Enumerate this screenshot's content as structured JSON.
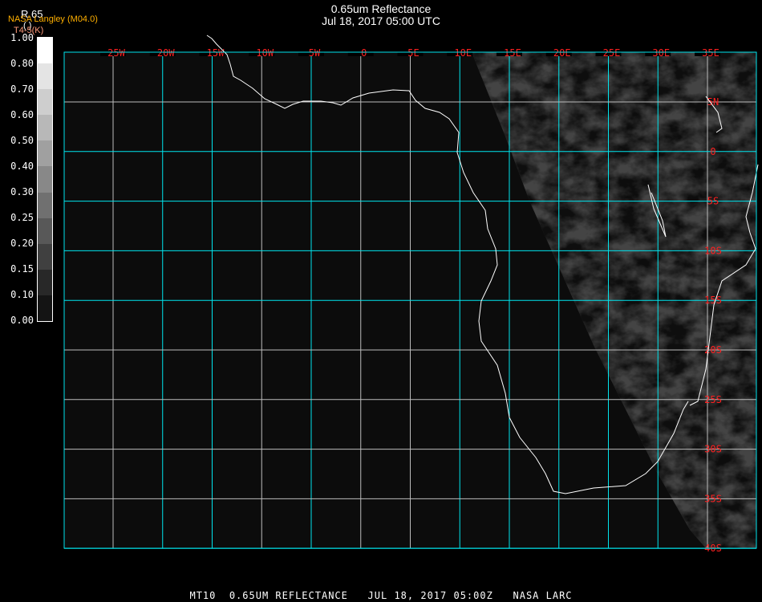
{
  "header": {
    "title": "0.65um Reflectance",
    "subtitle": "Jul 18, 2017 05:00 UTC"
  },
  "legend": {
    "channel": "R.65",
    "source": "NASA Langley (M04.0)",
    "units": "( )",
    "secondary": "T4-5(K)",
    "ticks": [
      "1.00",
      "0.80",
      "0.70",
      "0.60",
      "0.50",
      "0.40",
      "0.30",
      "0.25",
      "0.20",
      "0.15",
      "0.10",
      "0.00"
    ],
    "colors": [
      "#ffffff",
      "#e4e4e4",
      "#cecece",
      "#b8b8b8",
      "#a0a0a0",
      "#888888",
      "#707070",
      "#585858",
      "#404040",
      "#282828",
      "#141414"
    ]
  },
  "map": {
    "lon_labels": [
      "25W",
      "20W",
      "15W",
      "10W",
      "5W",
      "0",
      "5E",
      "10E",
      "15E",
      "20E",
      "25E",
      "30E",
      "35E"
    ],
    "lat_labels": [
      "5N",
      "0",
      "5S",
      "10S",
      "15S",
      "20S",
      "25S",
      "30S",
      "35S",
      "40S"
    ],
    "grid_color": "#00e5ee",
    "label_color": "#ff2020",
    "coast_color": "#ffffff"
  },
  "footer": {
    "text": "MT10  0.65UM REFLECTANCE   JUL 18, 2017 05:00Z   NASA LARC"
  }
}
